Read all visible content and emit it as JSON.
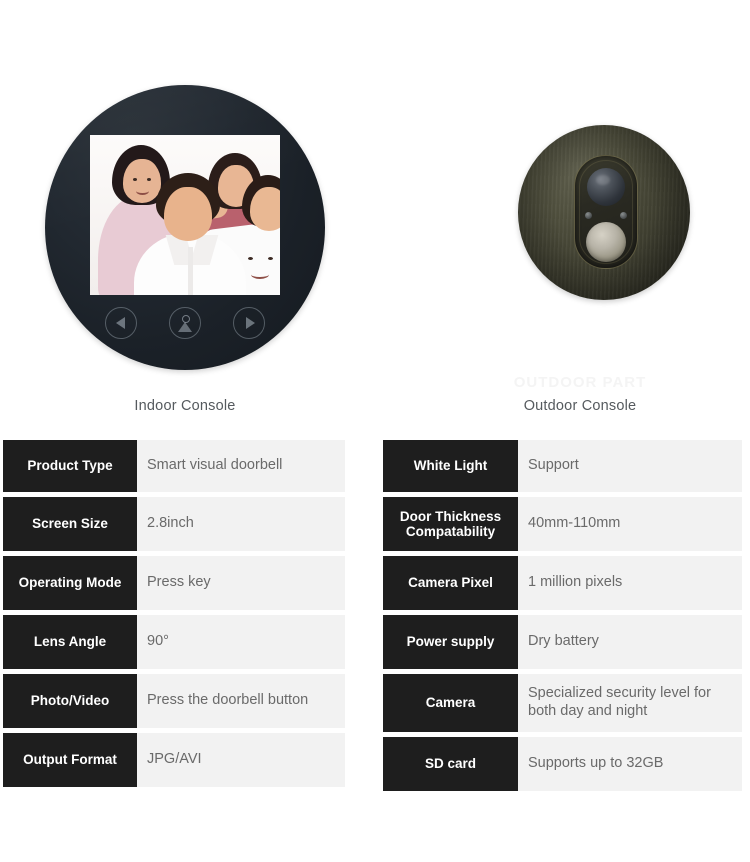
{
  "showcase": {
    "indoor": {
      "caption": "Indoor Console",
      "screen_photo_alt": "family-photo",
      "buttons": [
        {
          "name": "previous-button",
          "icon": "triangle-left-icon"
        },
        {
          "name": "contact-button",
          "icon": "person-icon"
        },
        {
          "name": "next-button",
          "icon": "triangle-right-icon"
        }
      ]
    },
    "outdoor": {
      "caption": "Outdoor Console",
      "watermark": "OUTDOOR PART",
      "parts": [
        {
          "name": "camera-lens",
          "icon": "camera-lens-icon"
        },
        {
          "name": "ir-led-left",
          "icon": "led-icon"
        },
        {
          "name": "ir-led-right",
          "icon": "led-icon"
        },
        {
          "name": "doorbell-button",
          "icon": "doorbell-button-icon"
        }
      ]
    }
  },
  "specs": {
    "left": [
      {
        "label": "Product Type",
        "value": "Smart visual doorbell"
      },
      {
        "label": "Screen Size",
        "value": "2.8inch"
      },
      {
        "label": "Operating Mode",
        "value": "Press key"
      },
      {
        "label": "Lens Angle",
        "value": "90°"
      },
      {
        "label": "Photo/Video",
        "value": "Press the doorbell button"
      },
      {
        "label": "Output Format",
        "value": "JPG/AVI"
      }
    ],
    "right": [
      {
        "label": "White Light",
        "value": "Support"
      },
      {
        "label": "Door Thickness\nCompatability",
        "value": "40mm-110mm"
      },
      {
        "label": "Camera Pixel",
        "value": "1 million pixels"
      },
      {
        "label": "Power supply",
        "value": "Dry battery"
      },
      {
        "label": "Camera",
        "value": "Specialized security level for both day and night"
      },
      {
        "label": "SD card",
        "value": "Supports up to 32GB"
      }
    ]
  },
  "colors": {
    "page_background": "#ffffff",
    "label_cell": "#1e1e1e",
    "value_cell": "#f2f2f2",
    "value_text": "#6a6a6a",
    "caption_text": "#555a5e",
    "indoor_body": "#222931",
    "outdoor_body": "#4b4b3a"
  }
}
